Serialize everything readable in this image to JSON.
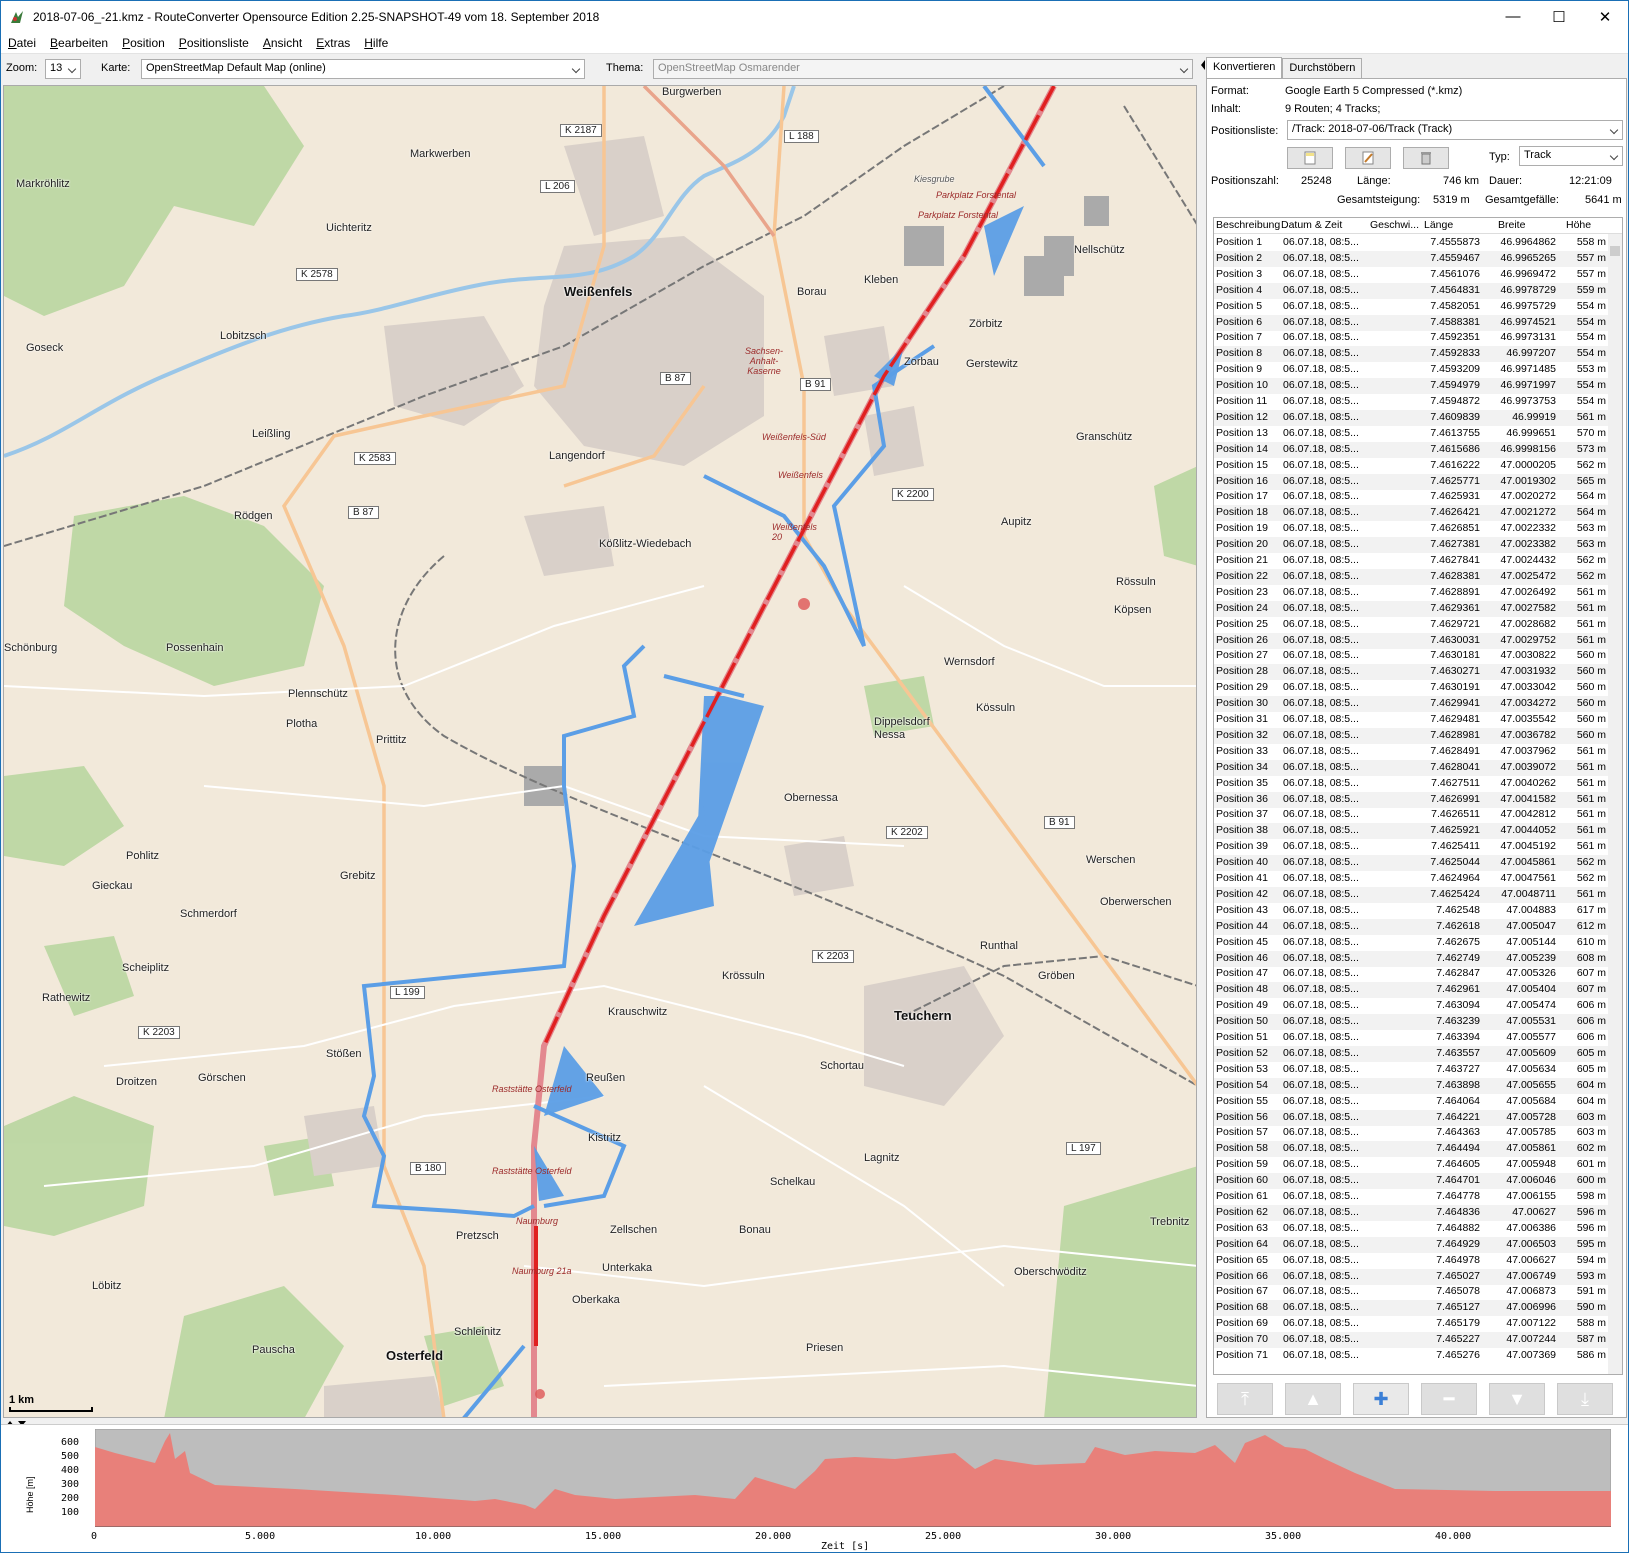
{
  "window": {
    "title": "2018-07-06_-21.kmz - RouteConverter Opensource Edition 2.25-SNAPSHOT-49 vom 18. September 2018",
    "minimize": "—",
    "maximize": "☐",
    "close": "✕"
  },
  "menu": [
    "Datei",
    "Bearbeiten",
    "Position",
    "Positionsliste",
    "Ansicht",
    "Extras",
    "Hilfe"
  ],
  "toolbar": {
    "zoom_label": "Zoom:",
    "zoom_value": "13",
    "map_label": "Karte:",
    "map_value": "OpenStreetMap Default Map (online)",
    "theme_label": "Thema:",
    "theme_value": "OpenStreetMap Osmarender"
  },
  "map": {
    "scale": "1 km",
    "towns": [
      {
        "name": "Burgwerben",
        "big": false
      },
      {
        "name": "Markwerben",
        "big": false
      },
      {
        "name": "Markröhlitz",
        "big": false
      },
      {
        "name": "Uichteritz",
        "big": false
      },
      {
        "name": "Weißenfels",
        "big": true
      },
      {
        "name": "Borau",
        "big": false
      },
      {
        "name": "Kleben",
        "big": false
      },
      {
        "name": "Nellschütz",
        "big": false
      },
      {
        "name": "Goseck",
        "big": false
      },
      {
        "name": "Lobitzsch",
        "big": false
      },
      {
        "name": "Zörbitz",
        "big": false
      },
      {
        "name": "Zorbau",
        "big": false
      },
      {
        "name": "Gerstewitz",
        "big": false
      },
      {
        "name": "Leißling",
        "big": false
      },
      {
        "name": "Langendorf",
        "big": false
      },
      {
        "name": "Granschütz",
        "big": false
      },
      {
        "name": "Rödgen",
        "big": false
      },
      {
        "name": "Aupitz",
        "big": false
      },
      {
        "name": "Kößlitz-Wiedebach",
        "big": false
      },
      {
        "name": "Rössuln",
        "big": false
      },
      {
        "name": "Köpsen",
        "big": false
      },
      {
        "name": "Schönburg",
        "big": false
      },
      {
        "name": "Possenhain",
        "big": false
      },
      {
        "name": "Wernsdorf",
        "big": false
      },
      {
        "name": "Plennschütz",
        "big": false
      },
      {
        "name": "Plotha",
        "big": false
      },
      {
        "name": "Kössuln",
        "big": false
      },
      {
        "name": "Dippelsdorf",
        "big": false
      },
      {
        "name": "Nessa",
        "big": false
      },
      {
        "name": "Prittitz",
        "big": false
      },
      {
        "name": "Obernessa",
        "big": false
      },
      {
        "name": "Pohlitz",
        "big": false
      },
      {
        "name": "Werschen",
        "big": false
      },
      {
        "name": "Gieckau",
        "big": false
      },
      {
        "name": "Grebitz",
        "big": false
      },
      {
        "name": "Schmerdorf",
        "big": false
      },
      {
        "name": "Oberwerschen",
        "big": false
      },
      {
        "name": "Runthal",
        "big": false
      },
      {
        "name": "Scheiplitz",
        "big": false
      },
      {
        "name": "Krössuln",
        "big": false
      },
      {
        "name": "Gröben",
        "big": false
      },
      {
        "name": "Rathewitz",
        "big": false
      },
      {
        "name": "Teuchern",
        "big": true
      },
      {
        "name": "Krauschwitz",
        "big": false
      },
      {
        "name": "Stößen",
        "big": false
      },
      {
        "name": "Droitzen",
        "big": false
      },
      {
        "name": "Görschen",
        "big": false
      },
      {
        "name": "Reußen",
        "big": false
      },
      {
        "name": "Schortau",
        "big": false
      },
      {
        "name": "Kistritz",
        "big": false
      },
      {
        "name": "Lagnitz",
        "big": false
      },
      {
        "name": "Schelkau",
        "big": false
      },
      {
        "name": "Zellschen",
        "big": false
      },
      {
        "name": "Bonau",
        "big": false
      },
      {
        "name": "Pretzsch",
        "big": false
      },
      {
        "name": "Trebnitz",
        "big": false
      },
      {
        "name": "Unterkaka",
        "big": false
      },
      {
        "name": "Oberschwöditz",
        "big": false
      },
      {
        "name": "Löbitz",
        "big": false
      },
      {
        "name": "Oberkaka",
        "big": false
      },
      {
        "name": "Schleinitz",
        "big": false
      },
      {
        "name": "Pauscha",
        "big": false
      },
      {
        "name": "Osterfeld",
        "big": true
      },
      {
        "name": "Priesen",
        "big": false
      },
      {
        "name": "Kiesgrube",
        "big": false
      }
    ],
    "roads": [
      "K 2187",
      "L 188",
      "L 206",
      "K 2578",
      "B 87",
      "B 91",
      "K 2583",
      "B 87",
      "K 2200",
      "K 2202",
      "B 91",
      "K 2203",
      "L 199",
      "K 2203",
      "B 180",
      "L 197"
    ],
    "rest_stops": [
      "Parkplatz Forstental",
      "Parkplatz Forstental",
      "Sachsen-Anhalt-Kaserne",
      "Weißenfels-Süd",
      "Weißenfels",
      "Weißenfels 20",
      "Raststätte Osterfeld",
      "Raststätte Osterfeld",
      "Naumburg",
      "Naumburg 21a"
    ],
    "route_color": "#e02020",
    "track_color": "#5b9ee6"
  },
  "panel": {
    "tabs": [
      "Konvertieren",
      "Durchstöbern"
    ],
    "format_label": "Format:",
    "format_value": "Google Earth 5 Compressed (*.kmz)",
    "content_label": "Inhalt:",
    "content_value": "9 Routen; 4 Tracks;",
    "poslist_label": "Positionsliste:",
    "poslist_value": "/Track: 2018-07-06/Track (Track)",
    "type_label": "Typ:",
    "type_value": "Track",
    "count_label": "Positionszahl:",
    "count_value": "25248",
    "length_label": "Länge:",
    "length_value": "746 km",
    "duration_label": "Dauer:",
    "duration_value": "12:21:09",
    "ascent_label": "Gesamtsteigung:",
    "ascent_value": "5319 m",
    "descent_label": "Gesamtgefälle:",
    "descent_value": "5641 m",
    "columns": [
      "Beschreibung",
      "Datum & Zeit",
      "Geschwi...",
      "Länge",
      "Breite",
      "Höhe"
    ],
    "rows": [
      [
        "Position 1",
        "06.07.18, 08:5...",
        "7.4555873",
        "46.9964862",
        "558 m"
      ],
      [
        "Position 2",
        "06.07.18, 08:5...",
        "7.4559467",
        "46.9965265",
        "557 m"
      ],
      [
        "Position 3",
        "06.07.18, 08:5...",
        "7.4561076",
        "46.9969472",
        "557 m"
      ],
      [
        "Position 4",
        "06.07.18, 08:5...",
        "7.4564831",
        "46.9978729",
        "559 m"
      ],
      [
        "Position 5",
        "06.07.18, 08:5...",
        "7.4582051",
        "46.9975729",
        "554 m"
      ],
      [
        "Position 6",
        "06.07.18, 08:5...",
        "7.4588381",
        "46.9974521",
        "554 m"
      ],
      [
        "Position 7",
        "06.07.18, 08:5...",
        "7.4592351",
        "46.9973131",
        "554 m"
      ],
      [
        "Position 8",
        "06.07.18, 08:5...",
        "7.4592833",
        "46.997207",
        "554 m"
      ],
      [
        "Position 9",
        "06.07.18, 08:5...",
        "7.4593209",
        "46.9971485",
        "553 m"
      ],
      [
        "Position 10",
        "06.07.18, 08:5...",
        "7.4594979",
        "46.9971997",
        "554 m"
      ],
      [
        "Position 11",
        "06.07.18, 08:5...",
        "7.4594872",
        "46.9973753",
        "554 m"
      ],
      [
        "Position 12",
        "06.07.18, 08:5...",
        "7.4609839",
        "46.99919",
        "561 m"
      ],
      [
        "Position 13",
        "06.07.18, 08:5...",
        "7.4613755",
        "46.999651",
        "570 m"
      ],
      [
        "Position 14",
        "06.07.18, 08:5...",
        "7.4615686",
        "46.9998156",
        "573 m"
      ],
      [
        "Position 15",
        "06.07.18, 08:5...",
        "7.4616222",
        "47.0000205",
        "562 m"
      ],
      [
        "Position 16",
        "06.07.18, 08:5...",
        "7.4625771",
        "47.0019302",
        "565 m"
      ],
      [
        "Position 17",
        "06.07.18, 08:5...",
        "7.4625931",
        "47.0020272",
        "564 m"
      ],
      [
        "Position 18",
        "06.07.18, 08:5...",
        "7.4626421",
        "47.0021272",
        "564 m"
      ],
      [
        "Position 19",
        "06.07.18, 08:5...",
        "7.4626851",
        "47.0022332",
        "563 m"
      ],
      [
        "Position 20",
        "06.07.18, 08:5...",
        "7.4627381",
        "47.0023382",
        "563 m"
      ],
      [
        "Position 21",
        "06.07.18, 08:5...",
        "7.4627841",
        "47.0024432",
        "562 m"
      ],
      [
        "Position 22",
        "06.07.18, 08:5...",
        "7.4628381",
        "47.0025472",
        "562 m"
      ],
      [
        "Position 23",
        "06.07.18, 08:5...",
        "7.4628891",
        "47.0026492",
        "561 m"
      ],
      [
        "Position 24",
        "06.07.18, 08:5...",
        "7.4629361",
        "47.0027582",
        "561 m"
      ],
      [
        "Position 25",
        "06.07.18, 08:5...",
        "7.4629721",
        "47.0028682",
        "561 m"
      ],
      [
        "Position 26",
        "06.07.18, 08:5...",
        "7.4630031",
        "47.0029752",
        "561 m"
      ],
      [
        "Position 27",
        "06.07.18, 08:5...",
        "7.4630181",
        "47.0030822",
        "560 m"
      ],
      [
        "Position 28",
        "06.07.18, 08:5...",
        "7.4630271",
        "47.0031932",
        "560 m"
      ],
      [
        "Position 29",
        "06.07.18, 08:5...",
        "7.4630191",
        "47.0033042",
        "560 m"
      ],
      [
        "Position 30",
        "06.07.18, 08:5...",
        "7.4629941",
        "47.0034272",
        "560 m"
      ],
      [
        "Position 31",
        "06.07.18, 08:5...",
        "7.4629481",
        "47.0035542",
        "560 m"
      ],
      [
        "Position 32",
        "06.07.18, 08:5...",
        "7.4628981",
        "47.0036782",
        "560 m"
      ],
      [
        "Position 33",
        "06.07.18, 08:5...",
        "7.4628491",
        "47.0037962",
        "561 m"
      ],
      [
        "Position 34",
        "06.07.18, 08:5...",
        "7.4628041",
        "47.0039072",
        "561 m"
      ],
      [
        "Position 35",
        "06.07.18, 08:5...",
        "7.4627511",
        "47.0040262",
        "561 m"
      ],
      [
        "Position 36",
        "06.07.18, 08:5...",
        "7.4626991",
        "47.0041582",
        "561 m"
      ],
      [
        "Position 37",
        "06.07.18, 08:5...",
        "7.4626511",
        "47.0042812",
        "561 m"
      ],
      [
        "Position 38",
        "06.07.18, 08:5...",
        "7.4625921",
        "47.0044052",
        "561 m"
      ],
      [
        "Position 39",
        "06.07.18, 08:5...",
        "7.4625411",
        "47.0045192",
        "561 m"
      ],
      [
        "Position 40",
        "06.07.18, 08:5...",
        "7.4625044",
        "47.0045861",
        "562 m"
      ],
      [
        "Position 41",
        "06.07.18, 08:5...",
        "7.4624964",
        "47.0047561",
        "562 m"
      ],
      [
        "Position 42",
        "06.07.18, 08:5...",
        "7.4625424",
        "47.0048711",
        "561 m"
      ],
      [
        "Position 43",
        "06.07.18, 08:5...",
        "7.462548",
        "47.004883",
        "617 m"
      ],
      [
        "Position 44",
        "06.07.18, 08:5...",
        "7.462618",
        "47.005047",
        "612 m"
      ],
      [
        "Position 45",
        "06.07.18, 08:5...",
        "7.462675",
        "47.005144",
        "610 m"
      ],
      [
        "Position 46",
        "06.07.18, 08:5...",
        "7.462749",
        "47.005239",
        "608 m"
      ],
      [
        "Position 47",
        "06.07.18, 08:5...",
        "7.462847",
        "47.005326",
        "607 m"
      ],
      [
        "Position 48",
        "06.07.18, 08:5...",
        "7.462961",
        "47.005404",
        "607 m"
      ],
      [
        "Position 49",
        "06.07.18, 08:5...",
        "7.463094",
        "47.005474",
        "606 m"
      ],
      [
        "Position 50",
        "06.07.18, 08:5...",
        "7.463239",
        "47.005531",
        "606 m"
      ],
      [
        "Position 51",
        "06.07.18, 08:5...",
        "7.463394",
        "47.005577",
        "606 m"
      ],
      [
        "Position 52",
        "06.07.18, 08:5...",
        "7.463557",
        "47.005609",
        "605 m"
      ],
      [
        "Position 53",
        "06.07.18, 08:5...",
        "7.463727",
        "47.005634",
        "605 m"
      ],
      [
        "Position 54",
        "06.07.18, 08:5...",
        "7.463898",
        "47.005655",
        "604 m"
      ],
      [
        "Position 55",
        "06.07.18, 08:5...",
        "7.464064",
        "47.005684",
        "604 m"
      ],
      [
        "Position 56",
        "06.07.18, 08:5...",
        "7.464221",
        "47.005728",
        "603 m"
      ],
      [
        "Position 57",
        "06.07.18, 08:5...",
        "7.464363",
        "47.005785",
        "603 m"
      ],
      [
        "Position 58",
        "06.07.18, 08:5...",
        "7.464494",
        "47.005861",
        "602 m"
      ],
      [
        "Position 59",
        "06.07.18, 08:5...",
        "7.464605",
        "47.005948",
        "601 m"
      ],
      [
        "Position 60",
        "06.07.18, 08:5...",
        "7.464701",
        "47.006046",
        "600 m"
      ],
      [
        "Position 61",
        "06.07.18, 08:5...",
        "7.464778",
        "47.006155",
        "598 m"
      ],
      [
        "Position 62",
        "06.07.18, 08:5...",
        "7.464836",
        "47.00627",
        "596 m"
      ],
      [
        "Position 63",
        "06.07.18, 08:5...",
        "7.464882",
        "47.006386",
        "596 m"
      ],
      [
        "Position 64",
        "06.07.18, 08:5...",
        "7.464929",
        "47.006503",
        "595 m"
      ],
      [
        "Position 65",
        "06.07.18, 08:5...",
        "7.464978",
        "47.006627",
        "594 m"
      ],
      [
        "Position 66",
        "06.07.18, 08:5...",
        "7.465027",
        "47.006749",
        "593 m"
      ],
      [
        "Position 67",
        "06.07.18, 08:5...",
        "7.465078",
        "47.006873",
        "591 m"
      ],
      [
        "Position 68",
        "06.07.18, 08:5...",
        "7.465127",
        "47.006996",
        "590 m"
      ],
      [
        "Position 69",
        "06.07.18, 08:5...",
        "7.465179",
        "47.007122",
        "588 m"
      ],
      [
        "Position 70",
        "06.07.18, 08:5...",
        "7.465227",
        "47.007244",
        "587 m"
      ],
      [
        "Position 71",
        "06.07.18, 08:5...",
        "7.465276",
        "47.007369",
        "586 m"
      ]
    ],
    "nav_icons": [
      "move-top-icon",
      "move-up-icon",
      "add-icon",
      "remove-icon",
      "move-down-icon",
      "move-bottom-icon"
    ]
  },
  "profile": {
    "y_label": "Höhe [m]",
    "x_label": "Zeit [s]",
    "y_ticks": [
      "600",
      "500",
      "400",
      "300",
      "200",
      "100"
    ],
    "x_ticks": [
      "0",
      "5.000",
      "10.000",
      "15.000",
      "20.000",
      "25.000",
      "30.000",
      "35.000",
      "40.000"
    ],
    "fill_color": "#e8807a",
    "bg_color": "#bdbdbd"
  }
}
